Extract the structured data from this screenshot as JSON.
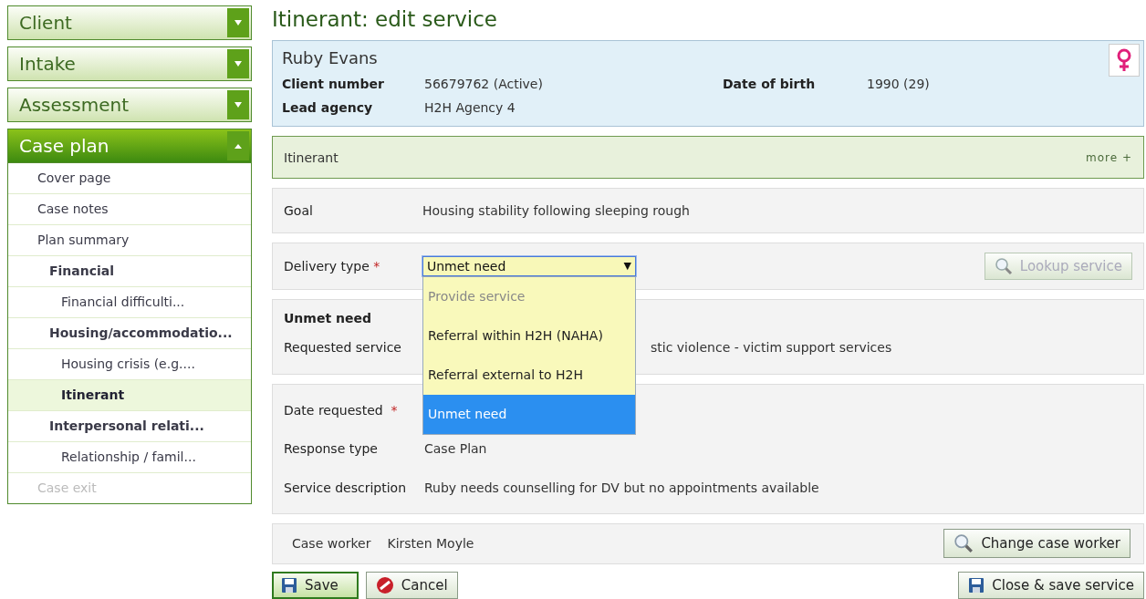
{
  "sidebar": {
    "sections": [
      {
        "label": "Client",
        "expanded": false
      },
      {
        "label": "Intake",
        "expanded": false
      },
      {
        "label": "Assessment",
        "expanded": false
      },
      {
        "label": "Case plan",
        "expanded": true,
        "items": [
          {
            "label": "Cover page",
            "selected": false,
            "disabled": false
          },
          {
            "label": "Case notes",
            "selected": false,
            "disabled": false
          },
          {
            "label": "Plan summary",
            "selected": false,
            "disabled": false,
            "children": [
              {
                "label": "Financial",
                "selected": false,
                "disabled": false,
                "children": [
                  {
                    "label": "Financial difficulti...",
                    "selected": false,
                    "disabled": false
                  }
                ]
              },
              {
                "label": "Housing/accommodatio...",
                "selected": false,
                "disabled": false,
                "children": [
                  {
                    "label": "Housing crisis (e.g....",
                    "selected": false,
                    "disabled": false
                  },
                  {
                    "label": "Itinerant",
                    "selected": true,
                    "disabled": false
                  }
                ]
              },
              {
                "label": "Interpersonal relati...",
                "selected": false,
                "disabled": false,
                "children": [
                  {
                    "label": "Relationship / famil...",
                    "selected": false,
                    "disabled": false
                  }
                ]
              }
            ]
          },
          {
            "label": "Case exit",
            "selected": false,
            "disabled": true
          }
        ]
      }
    ]
  },
  "page_title": "Itinerant: edit service",
  "client": {
    "name": "Ruby Evans",
    "fields": [
      {
        "label": "Client number",
        "value": "56679762 (Active)"
      },
      {
        "label": "Date of birth",
        "value": "1990 (29)"
      },
      {
        "label": "Lead agency",
        "value": "H2H Agency 4"
      }
    ]
  },
  "service_bar": {
    "title": "Itinerant",
    "more": "more +"
  },
  "goal": {
    "label": "Goal",
    "value": "Housing stability following sleeping rough"
  },
  "delivery": {
    "label": "Delivery type",
    "required_mark": "*",
    "value": "Unmet need",
    "caret": "▼",
    "expanded": true,
    "options": [
      {
        "label": "Provide service",
        "selected": false,
        "disabled": true
      },
      {
        "label": "Referral within H2H (NAHA)",
        "selected": false,
        "disabled": false
      },
      {
        "label": "Referral external to H2H",
        "selected": false,
        "disabled": false
      },
      {
        "label": "Unmet need",
        "selected": true,
        "disabled": false
      }
    ],
    "lookup_button": {
      "label": "Lookup service",
      "disabled": true
    }
  },
  "unmet": {
    "heading": "Unmet need",
    "label": "Requested service",
    "value": "stic violence - victim support services"
  },
  "details": [
    {
      "label": "Date requested",
      "required_mark": "*"
    },
    {
      "label": "Response type",
      "value": "Case Plan"
    },
    {
      "label": "Service description",
      "value": "Ruby needs counselling for DV but no appointments available"
    }
  ],
  "case_worker": {
    "label": "Case worker",
    "value": "Kirsten Moyle",
    "button": "Change case worker"
  },
  "buttons": {
    "save": "Save",
    "cancel": "Cancel",
    "close_save": "Close & save service"
  }
}
